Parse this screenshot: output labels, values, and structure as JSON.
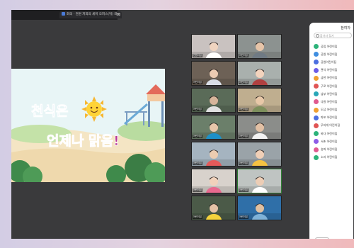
{
  "tab": {
    "title": "회의 · 천원 저희의 세미 오피스(뒤) 와"
  },
  "shared_screen": {
    "line1": "천식은",
    "line2": "언제나 맑음!"
  },
  "video_tiles": [
    {
      "label": "천원이집",
      "bg": "#c9c2c0",
      "skin": "#f0d4c0",
      "shirt": "#ffffff"
    },
    {
      "label": "어린이집",
      "bg": "#8c9290",
      "skin": "#e6c4a8",
      "shirt": "#6f7a84"
    },
    {
      "label": "어린이집",
      "bg": "#6d6156",
      "skin": "#eccbb2",
      "shirt": "#d8dde6"
    },
    {
      "label": "어린이집",
      "bg": "#a9b0ad",
      "skin": "#f3d3bd",
      "shirt": "#b04040"
    },
    {
      "label": "어린이집",
      "bg": "#5a6b58",
      "skin": "#d6b49a",
      "shirt": "#e0e0e0"
    },
    {
      "label": "어린이집",
      "bg": "#bfae8f",
      "skin": "#e8c8a8",
      "shirt": "#7d8f5c"
    },
    {
      "label": "어린이집",
      "bg": "#6b7f6a",
      "skin": "#e8c6aa",
      "shirt": "#1e90c8"
    },
    {
      "label": "어린이집",
      "bg": "#8b8d8a",
      "skin": "#e2c0a4",
      "shirt": "#f2f2f2"
    },
    {
      "label": "어린이집",
      "bg": "#a5b4c0",
      "skin": "#ecccb0",
      "shirt": "#e45a5a"
    },
    {
      "label": "어린이집",
      "bg": "#9aa3a8",
      "skin": "#f0cfb6",
      "shirt": "#f5c342"
    },
    {
      "label": "어린이집",
      "bg": "#d8d2cc",
      "skin": "#f1d2bb",
      "shirt": "#e86a8f"
    },
    {
      "label": "어린이집",
      "bg": "#bfc4c2",
      "skin": "#eccdb5",
      "shirt": "#ffffff"
    },
    {
      "label": "어린이집",
      "bg": "#4b5a48",
      "skin": "#e4c2a6",
      "shirt": "#f4d23c"
    },
    {
      "label": "어린이집",
      "bg": "#2f6fa8",
      "skin": "#e0c0a0",
      "shirt": "#7fb2d8"
    }
  ],
  "participants_panel": {
    "title": "참여자",
    "search_placeholder": "참가자 찾기",
    "items": [
      {
        "name": "공립 어린이집",
        "color": "#2db37a"
      },
      {
        "name": "공원 어린이집",
        "color": "#3f8ee0"
      },
      {
        "name": "공원어린이집",
        "color": "#4c6fe0"
      },
      {
        "name": "관악 어린이집",
        "color": "#6c5ce7"
      },
      {
        "name": "금천 어린이집",
        "color": "#f0a030"
      },
      {
        "name": "구로 어린이집",
        "color": "#e05555"
      },
      {
        "name": "남부 어린이집",
        "color": "#2aa7b8"
      },
      {
        "name": "다원 어린이집",
        "color": "#e05a8f"
      },
      {
        "name": "도담 어린이집",
        "color": "#f0a030"
      },
      {
        "name": "마포 어린이집",
        "color": "#4c6fe0"
      },
      {
        "name": "무지개 어린이집",
        "color": "#e05555"
      },
      {
        "name": "바다 어린이집",
        "color": "#2db37a"
      },
      {
        "name": "서초 어린이집",
        "color": "#8e5ce7"
      },
      {
        "name": "송파 어린이집",
        "color": "#e05a8f"
      },
      {
        "name": "소리 어린이집",
        "color": "#2db37a"
      }
    ],
    "button_label": "초대"
  }
}
